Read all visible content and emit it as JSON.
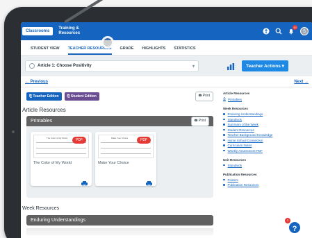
{
  "appbar": {
    "classrooms_label": "Classrooms",
    "training_label": "Training & Resources",
    "notification_count": "10",
    "avatar_initial": "S"
  },
  "tabs": [
    {
      "label": "STUDENT VIEW",
      "active": false
    },
    {
      "label": "TEACHER RESOURCES",
      "active": true
    },
    {
      "label": "GRADE",
      "active": false
    },
    {
      "label": "HIGHLIGHTS",
      "active": false
    },
    {
      "label": "STATISTICS",
      "active": false
    }
  ],
  "toolbar": {
    "article_select": "Article 1: Choose Positivity",
    "teacher_actions_label": "Teacher Actions"
  },
  "nav": {
    "previous": "Previous",
    "next": "Next"
  },
  "main": {
    "teacher_edition_label": "Teacher Edition",
    "student_edition_label": "Student Edition",
    "print_label": "Print",
    "article_resources_heading": "Article Resources",
    "printables_title": "Printables",
    "printables_print_label": "Print",
    "cards": [
      {
        "title": "The Color of My World",
        "badge": "PDF",
        "thumb_heading": "The Color of My World"
      },
      {
        "title": "Make Your Choice",
        "badge": "PDF",
        "thumb_heading": "Make Your Choice"
      }
    ],
    "week_resources_heading": "Week Resources",
    "enduring_title": "Enduring Understandings"
  },
  "side": {
    "article_resources": {
      "title": "Article Resources",
      "items": [
        "Printables"
      ]
    },
    "week_resources": {
      "title": "Week Resources",
      "items": [
        "Enduring Understandings",
        "Standards",
        "Summary of the Week",
        "Student Resources",
        "Teacher Background Knowledge",
        "Home School Connection",
        "Curriculum Notes",
        "Weekly Assessment PDF"
      ]
    },
    "unit_resources": {
      "title": "Unit Resources",
      "items": [
        "Standards"
      ]
    },
    "publication_resources": {
      "title": "Publication Resources",
      "items": [
        "Posters",
        "Publication Resources"
      ]
    }
  },
  "help": {
    "badge": "1",
    "label": "?"
  },
  "colors": {
    "primary": "#1565c0",
    "purple": "#6a4c93",
    "danger": "#e53935",
    "panel_header": "#616161"
  }
}
